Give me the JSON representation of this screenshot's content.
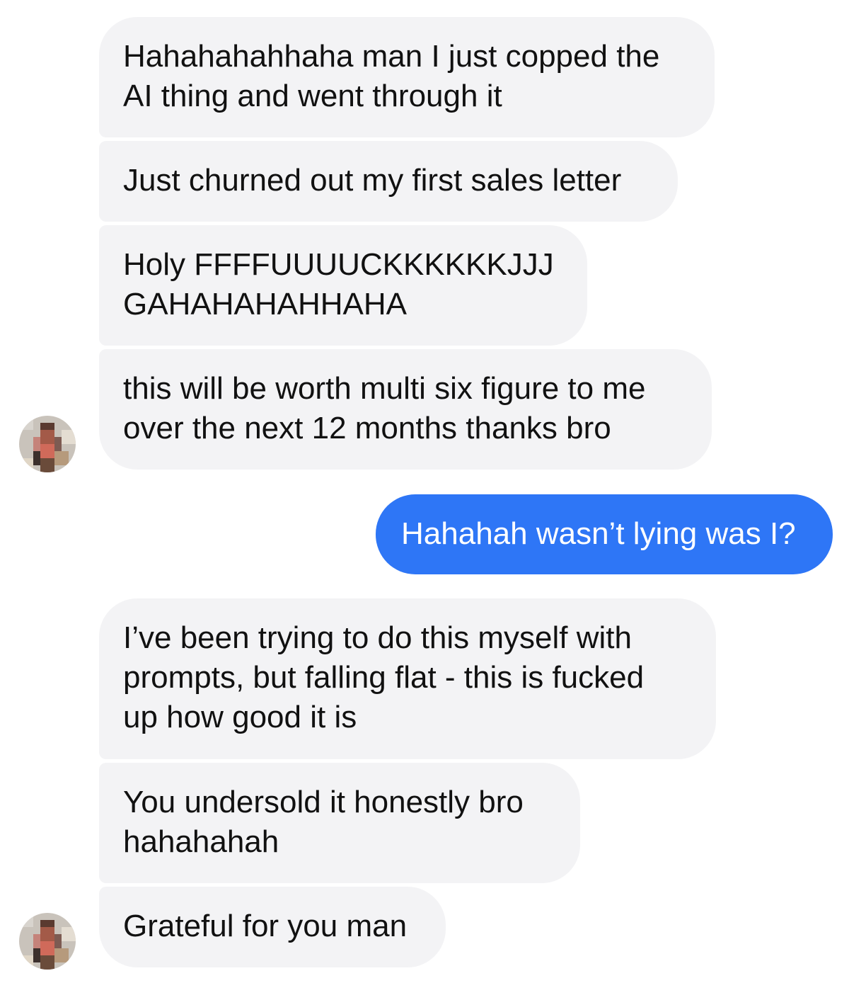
{
  "conversation": {
    "messages": [
      {
        "sender": "them",
        "text": "Hahahahahhaha man I just copped the\nAI thing and went through it"
      },
      {
        "sender": "them",
        "text": "Just churned out my first sales letter"
      },
      {
        "sender": "them",
        "text": "Holy FFFFUUUUCKKKKKKJJJ\nGAHAHAHAHHAHA"
      },
      {
        "sender": "them",
        "text": "this will be worth multi six figure to me\nover the next 12 months thanks bro"
      },
      {
        "sender": "me",
        "text": "Hahahah wasn’t lying was I?"
      },
      {
        "sender": "them",
        "text": "I’ve been trying to do this myself with\nprompts, but falling flat - this is fucked\nup how good it is"
      },
      {
        "sender": "them",
        "text": "You undersold it honestly bro\nhahahahah"
      },
      {
        "sender": "them",
        "text": "Grateful for you man"
      }
    ]
  },
  "colors": {
    "incoming_bubble": "#f3f3f5",
    "outgoing_bubble": "#2e76f6",
    "incoming_text": "#111111",
    "outgoing_text": "#ffffff"
  },
  "icons": {
    "avatar": "pixelated-avatar-icon"
  }
}
